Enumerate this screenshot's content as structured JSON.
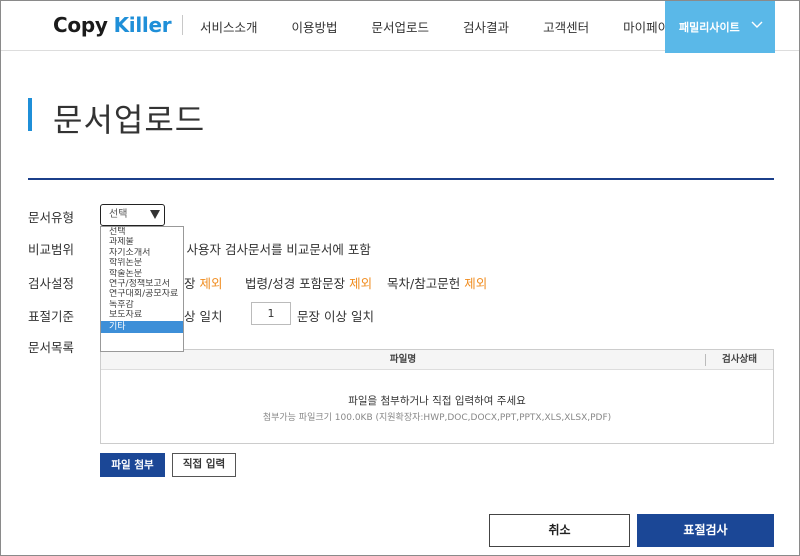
{
  "header": {
    "logo": {
      "copy": "Copy",
      "killer": "Killer"
    },
    "nav": [
      "서비스소개",
      "이용방법",
      "문서업로드",
      "검사결과",
      "고객센터",
      "마이페이지"
    ],
    "family_site": "패밀리사이트"
  },
  "page": {
    "title": "문서업로드"
  },
  "form": {
    "doc_type": {
      "label": "문서유형",
      "selected": "선택",
      "options": [
        "선택",
        "과제물",
        "자기소개서",
        "학위논문",
        "학술논문",
        "연구/정책보고서",
        "연구대회/공모자료",
        "독후감",
        "보도자료",
        "기타"
      ],
      "highlighted": "기타"
    },
    "compare": {
      "label": "비교범위",
      "text": "트 사용자 검사문서를 비교문서에 포함"
    },
    "settings": {
      "label": "검사설정",
      "item1_prefix": "장",
      "item1_action": "제외",
      "item2_prefix": "법령/성경 포함문장",
      "item2_action": "제외",
      "item3_prefix": "목차/참고문헌",
      "item3_action": "제외"
    },
    "criteria": {
      "label": "표절기준",
      "text1": "상 일치",
      "value": "1",
      "text2": "문장 이상 일치"
    },
    "doc_list": {
      "label": "문서목록"
    }
  },
  "table": {
    "col_file": "파일명",
    "col_status": "검사상태",
    "empty_main": "파일을 첨부하거나 직접 입력하여 주세요",
    "empty_sub": "첨부가능 파일크기 100.0KB (지원확장자:HWP,DOC,DOCX,PPT,PPTX,XLS,XLSX,PDF)"
  },
  "buttons": {
    "attach": "파일 첨부",
    "direct": "직접 입력",
    "cancel": "취소",
    "check": "표절검사"
  },
  "colors": {
    "brand_blue": "#1f8fd8",
    "navy": "#1b4796",
    "orange": "#f08c1e",
    "family_bg": "#5ab8e8"
  },
  "icons": {
    "select_arrow": "triangle-down",
    "family_arrow": "chevron-down"
  }
}
